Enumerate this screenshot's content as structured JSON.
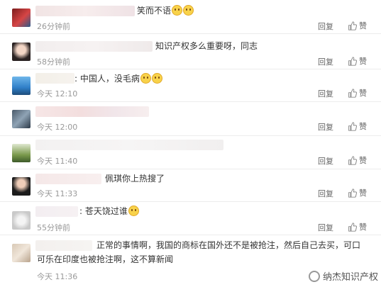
{
  "ui": {
    "reply_label": "回复",
    "like_label": "赞"
  },
  "comments": [
    {
      "text": "笑而不语",
      "time": "26分钟前",
      "emoji_count": 2
    },
    {
      "text": "知识产权多么重要呀，同志",
      "time": "58分钟前",
      "emoji_count": 0
    },
    {
      "text": ": 中国人，没毛病",
      "time": "今天 12:10",
      "emoji_count": 2
    },
    {
      "text": "",
      "time": "今天 12:00",
      "emoji_count": 0
    },
    {
      "text": "",
      "time": "今天 11:40",
      "emoji_count": 0
    },
    {
      "text": "佩琪你上热搜了",
      "time": "今天 11:33",
      "emoji_count": 0
    },
    {
      "text": ": 苍天饶过谁",
      "time": "55分钟前",
      "emoji_count": 1
    },
    {
      "text_line1": "正常的事情啊，我国的商标在国外还不是被抢注，然后自己去买，可口",
      "text_line2": "可乐在印度也被抢注啊，这不算新闻",
      "time": "今天 11:36",
      "emoji_count": 0
    }
  ],
  "watermark": {
    "text": "纳杰知识产权"
  },
  "colors": {
    "accent_emoji": "#f8d24a",
    "time_gray": "#999999",
    "divider": "#ececec"
  }
}
